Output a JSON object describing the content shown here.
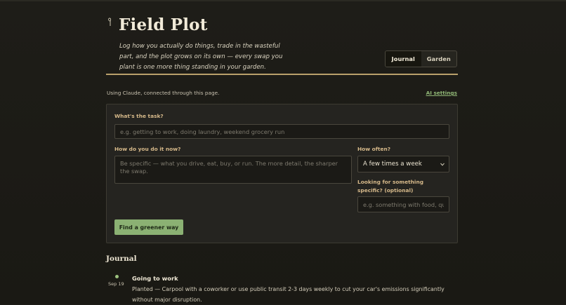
{
  "header": {
    "title": "Field Plot",
    "tagline": "Log how you actually do things, trade in the wasteful part, and the plot grows on its own — every swap you plant is one more thing standing in your garden.",
    "tabs": [
      {
        "label": "Journal",
        "active": true
      },
      {
        "label": "Garden",
        "active": false
      }
    ]
  },
  "status": {
    "connection_text": "Using Claude, connected through this page.",
    "settings_link": "AI settings"
  },
  "form": {
    "task_label": "What's the task?",
    "task_placeholder": "e.g. getting to work, doing laundry, weekend grocery run",
    "how_label": "How do you do it now?",
    "how_placeholder": "Be specific — what you drive, eat, buy, or run. The more detail, the sharper the swap.",
    "often_label": "How often?",
    "often_value": "A few times a week",
    "specific_label": "Looking for something specific? (optional)",
    "specific_placeholder": "e.g. something with food, quick",
    "submit_label": "Find a greener way"
  },
  "journal": {
    "heading": "Journal",
    "entries": [
      {
        "date": "Sep 19",
        "title": "Going to work",
        "body": "Planted — Carpool with a coworker or use public transit 2-3 days weekly to cut your car's emissions significantly without major disruption."
      }
    ]
  },
  "colors": {
    "accent_green": "#8bb173",
    "accent_gold": "#b9a06a",
    "background": "#1d1c17"
  },
  "icons": {
    "title_icon": "sprout-icon",
    "select_icon": "chevron-down-icon"
  }
}
